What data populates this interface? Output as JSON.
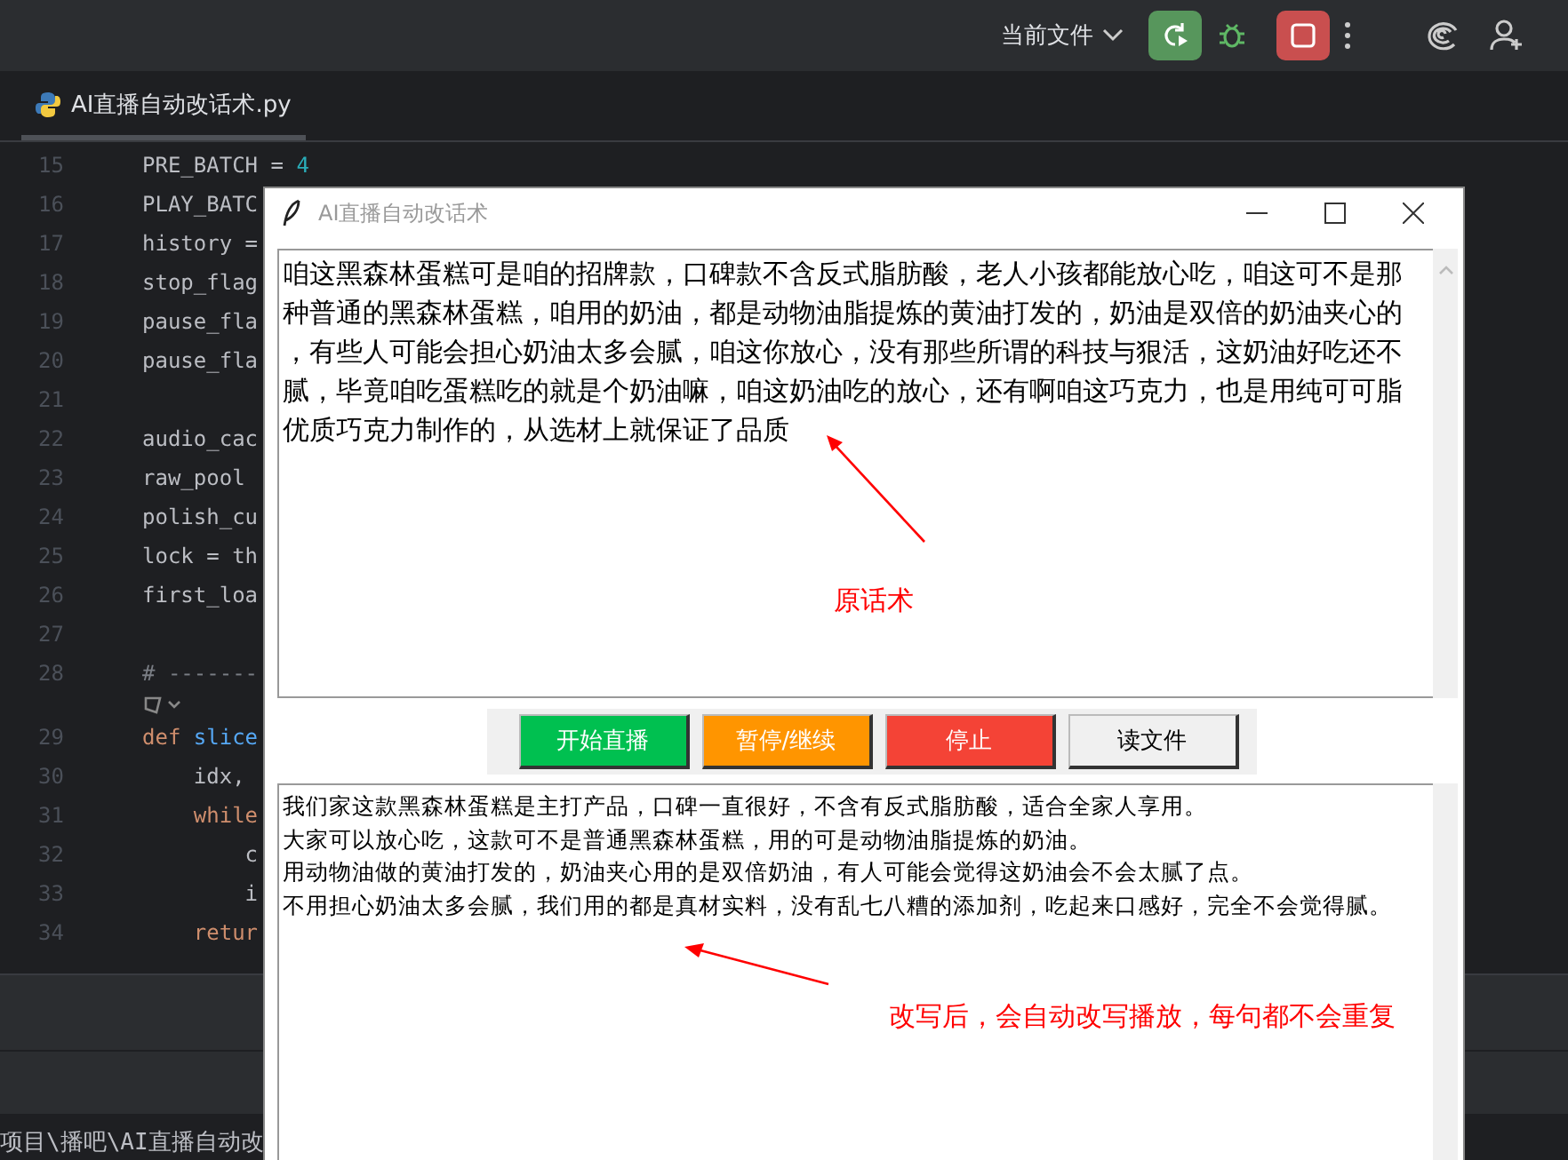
{
  "toolbar": {
    "run_config": "当前文件"
  },
  "tab": {
    "label": "AI直播自动改话术.py",
    "selected": true
  },
  "editor": {
    "lines": [
      {
        "kind": "code",
        "number": "15",
        "tokens": [
          {
            "text": "PRE_BATCH = ",
            "kind": "plain"
          },
          {
            "text": "4",
            "kind": "number"
          }
        ]
      },
      {
        "kind": "code",
        "number": "16",
        "tokens": [
          {
            "text": "PLAY_BATC",
            "kind": "plain"
          }
        ]
      },
      {
        "kind": "code",
        "number": "17",
        "tokens": [
          {
            "text": "history =",
            "kind": "plain"
          }
        ]
      },
      {
        "kind": "code",
        "number": "18",
        "tokens": [
          {
            "text": "stop_flag",
            "kind": "plain"
          }
        ]
      },
      {
        "kind": "code",
        "number": "19",
        "tokens": [
          {
            "text": "pause_fla",
            "kind": "plain"
          }
        ]
      },
      {
        "kind": "code",
        "number": "20",
        "tokens": [
          {
            "text": "pause_fla",
            "kind": "plain"
          }
        ]
      },
      {
        "kind": "code",
        "number": "21"
      },
      {
        "kind": "code",
        "number": "22",
        "tokens": [
          {
            "text": "audio_cac",
            "kind": "plain"
          }
        ]
      },
      {
        "kind": "code",
        "number": "23",
        "tokens": [
          {
            "text": "raw_pool",
            "kind": "plain"
          }
        ]
      },
      {
        "kind": "code",
        "number": "24",
        "tokens": [
          {
            "text": "polish_cu",
            "kind": "plain"
          }
        ]
      },
      {
        "kind": "code",
        "number": "25",
        "tokens": [
          {
            "text": "lock = th",
            "kind": "plain"
          }
        ]
      },
      {
        "kind": "code",
        "number": "26",
        "tokens": [
          {
            "text": "first_loa",
            "kind": "plain"
          }
        ]
      },
      {
        "kind": "code",
        "number": "27"
      },
      {
        "kind": "code",
        "number": "28",
        "tokens": [
          {
            "text": "# -------",
            "kind": "comment"
          }
        ]
      },
      {
        "kind": "hint"
      },
      {
        "kind": "code",
        "number": "29",
        "tokens": [
          {
            "text": "def ",
            "kind": "keyword"
          },
          {
            "text": "slice",
            "kind": "function"
          }
        ]
      },
      {
        "kind": "code",
        "number": "30",
        "tokens": [
          {
            "text": "    idx,",
            "kind": "plain"
          }
        ]
      },
      {
        "kind": "code",
        "number": "31",
        "tokens": [
          {
            "text": "    while",
            "kind": "keyword"
          }
        ]
      },
      {
        "kind": "code",
        "number": "32",
        "tokens": [
          {
            "text": "        c",
            "kind": "plain"
          }
        ]
      },
      {
        "kind": "code",
        "number": "33",
        "tokens": [
          {
            "text": "        i",
            "kind": "plain"
          }
        ]
      },
      {
        "kind": "code",
        "number": "34",
        "tokens": [
          {
            "text": "    retur",
            "kind": "keyword"
          }
        ]
      }
    ]
  },
  "path": "项目\\播吧\\AI直播自动改",
  "window": {
    "title": "AI直播自动改话术",
    "original_text": "咱这黑森林蛋糕可是咱的招牌款，口碑款不含反式脂肪酸，老人小孩都能放心吃，咱这可不是那种普通的黑森林蛋糕，咱用的奶油，都是动物油脂提炼的黄油打发的，奶油是双倍的奶油夹心的，有些人可能会担心奶油太多会腻，咱这你放心，没有那些所谓的科技与狠活，这奶油好吃还不腻，毕竟咱吃蛋糕吃的就是个奶油嘛，咱这奶油吃的放心，还有啊咱这巧克力，也是用纯可可脂优质巧克力制作的，从选材上就保证了品质",
    "buttons": [
      {
        "label": "开始直播",
        "color": "#00c050"
      },
      {
        "label": "暂停/继续",
        "color": "#ff9500"
      },
      {
        "label": "停止",
        "color": "#f44336"
      },
      {
        "label": "读文件",
        "color": "#f0f0f0"
      }
    ],
    "rewritten_lines": [
      "我们家这款黑森林蛋糕是主打产品，口碑一直很好，不含有反式脂肪酸，适合全家人享用。",
      "大家可以放心吃，这款可不是普通黑森林蛋糕，用的可是动物油脂提炼的奶油。",
      "用动物油做的黄油打发的，奶油夹心用的是双倍奶油，有人可能会觉得这奶油会不会太腻了点。",
      "不用担心奶油太多会腻，我们用的都是真材实料，没有乱七八糟的添加剂，吃起来口感好，完全不会觉得腻。"
    ]
  },
  "annotations": [
    {
      "label": "原话术"
    },
    {
      "label": "改写后，会自动改写播放，每句都不会重复"
    }
  ]
}
